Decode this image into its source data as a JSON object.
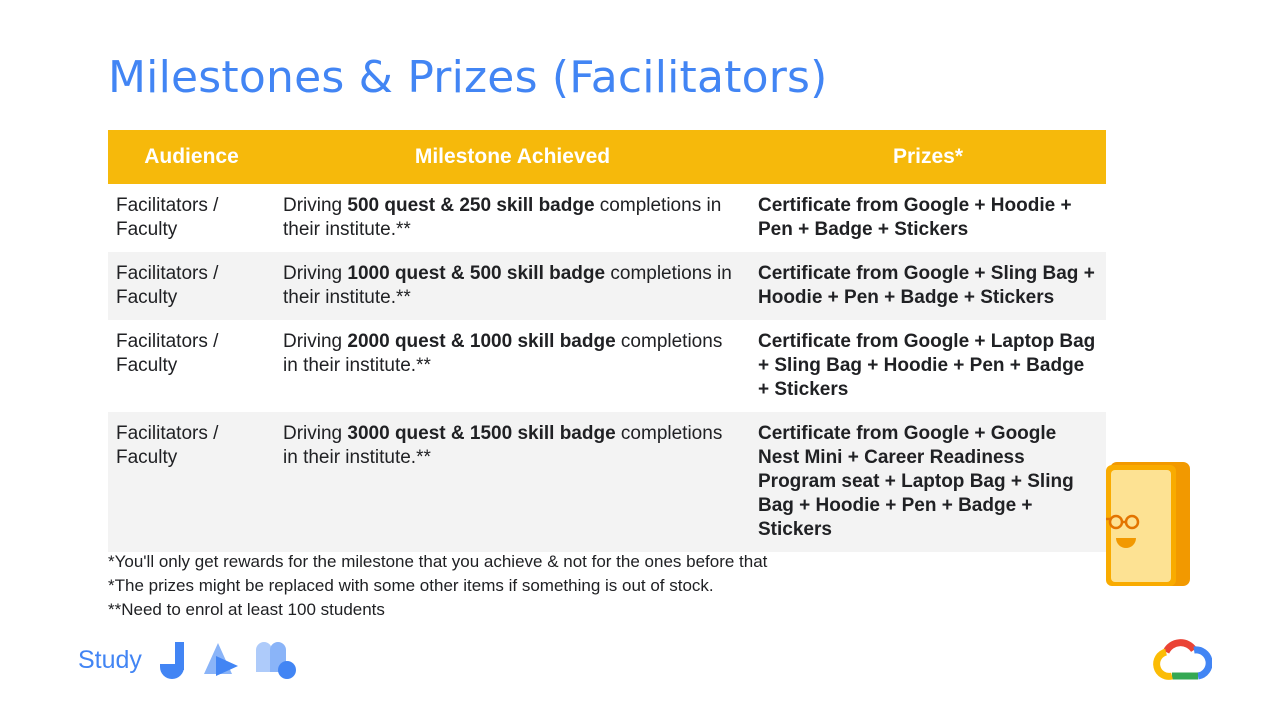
{
  "title": "Milestones & Prizes (Facilitators)",
  "table": {
    "headers": [
      "Audience",
      "Milestone Achieved",
      "Prizes*"
    ],
    "rows": [
      {
        "audience": "Facilitators / Faculty",
        "milestone_prefix": "Driving ",
        "milestone_bold": "500 quest & 250 skill badge",
        "milestone_suffix": " completions in their institute.**",
        "prize": "Certificate from Google + Hoodie + Pen + Badge + Stickers"
      },
      {
        "audience": "Facilitators / Faculty",
        "milestone_prefix": "Driving ",
        "milestone_bold": "1000 quest & 500 skill badge",
        "milestone_suffix": " completions in their institute.**",
        "prize": "Certificate from Google + Sling Bag + Hoodie + Pen + Badge + Stickers"
      },
      {
        "audience": "Facilitators / Faculty",
        "milestone_prefix": "Driving ",
        "milestone_bold": "2000 quest & 1000 skill badge",
        "milestone_suffix": " completions in their institute.**",
        "prize": "Certificate from Google + Laptop Bag + Sling Bag + Hoodie + Pen + Badge + Stickers"
      },
      {
        "audience": "Facilitators / Faculty",
        "milestone_prefix": "Driving ",
        "milestone_bold": "3000 quest & 1500 skill badge",
        "milestone_suffix": " completions in their institute.**",
        "prize": "Certificate from Google + Google Nest Mini + Career Readiness Program seat + Laptop Bag + Sling Bag + Hoodie + Pen + Badge + Stickers"
      }
    ]
  },
  "notes": [
    "*You'll only get rewards for the milestone that you achieve & not for the ones before that",
    "*The prizes might be replaced with some other items if something is out of stock.",
    "**Need to enrol at least 100 students"
  ],
  "footer": {
    "study_label": "Study",
    "icons": [
      "study-jam-j-icon",
      "study-jam-a-icon",
      "study-jam-m-icon",
      "phone-illustration-icon",
      "google-cloud-logo-icon"
    ]
  },
  "colors": {
    "title_blue": "#4285f4",
    "header_yellow": "#f6b90b",
    "alt_row_gray": "#f3f3f3"
  }
}
